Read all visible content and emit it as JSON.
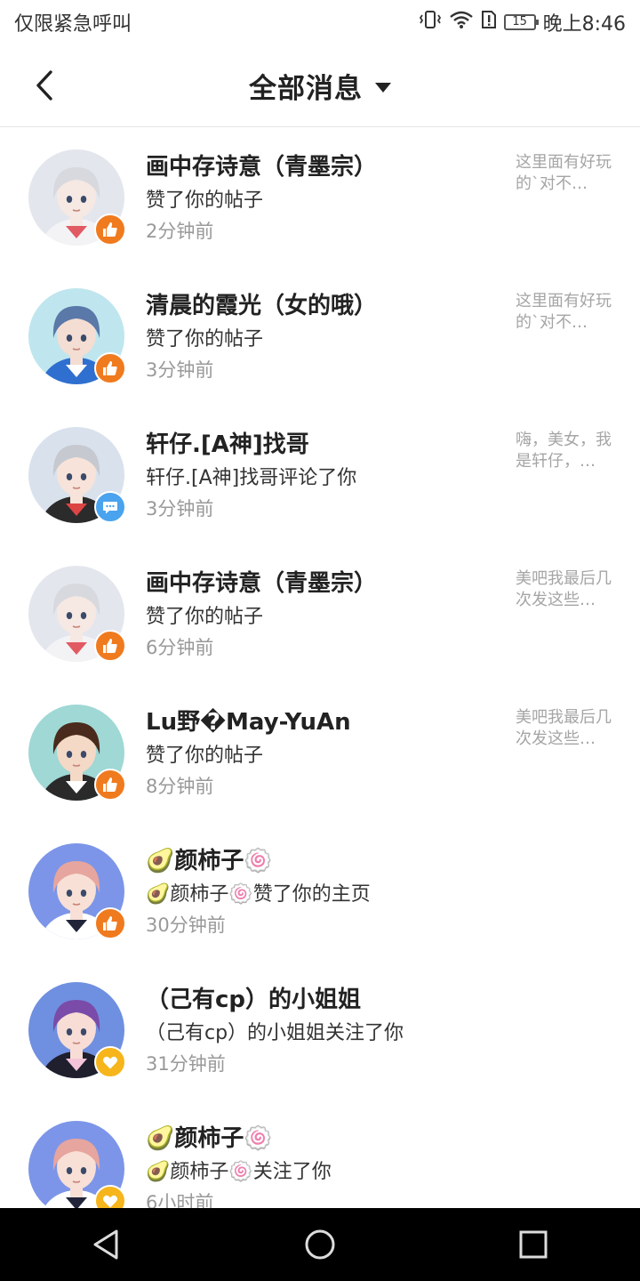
{
  "status_bar": {
    "carrier": "仅限紧急呼叫",
    "battery": "15",
    "battery_level_percent": 15,
    "time": "晚上8:46",
    "icons": [
      "vibrate-icon",
      "wifi-icon",
      "sim-alert-icon",
      "battery-icon"
    ]
  },
  "header": {
    "title": "全部消息",
    "back_icon": "chevron-left-icon",
    "dropdown_icon": "caret-down-icon"
  },
  "colors": {
    "like_badge": "#f07a1e",
    "comment_badge": "#4aa3ee",
    "follow_badge": "#f6b51b"
  },
  "messages": [
    {
      "name": "画中存诗意（青墨宗）",
      "action": "赞了你的帖子",
      "time": "2分钟前",
      "preview": "这里面有好玩的`对不…",
      "badge": "like",
      "badge_icon": "thumbs-up-icon"
    },
    {
      "name": "清晨的霞光（女的哦）",
      "action": "赞了你的帖子",
      "time": "3分钟前",
      "preview": "这里面有好玩的`对不…",
      "badge": "like",
      "badge_icon": "thumbs-up-icon"
    },
    {
      "name": "轩仔.[A神]找哥",
      "action": "轩仔.[A神]找哥评论了你",
      "time": "3分钟前",
      "preview": "嗨，美女，我是轩仔，…",
      "badge": "comment",
      "badge_icon": "comment-icon"
    },
    {
      "name": "画中存诗意（青墨宗）",
      "action": "赞了你的帖子",
      "time": "6分钟前",
      "preview": "美吧我最后几次发这些…",
      "badge": "like",
      "badge_icon": "thumbs-up-icon"
    },
    {
      "name": "Lu野�May-YuAn",
      "action": "赞了你的帖子",
      "time": "8分钟前",
      "preview": "美吧我最后几次发这些…",
      "badge": "like",
      "badge_icon": "thumbs-up-icon"
    },
    {
      "name": "🥑颜柿子🍥",
      "action": "🥑颜柿子🍥赞了你的主页",
      "time": "30分钟前",
      "preview": "",
      "badge": "like",
      "badge_icon": "thumbs-up-icon"
    },
    {
      "name": "（己有cp）的小姐姐",
      "action": "（己有cp）的小姐姐关注了你",
      "time": "31分钟前",
      "preview": "",
      "badge": "follow",
      "badge_icon": "heart-icon"
    },
    {
      "name": "🥑颜柿子🍥",
      "action": "🥑颜柿子🍥关注了你",
      "time": "6小时前",
      "preview": "",
      "badge": "follow",
      "badge_icon": "heart-icon"
    }
  ],
  "nav_bar": {
    "back": "triangle-back-icon",
    "home": "circle-home-icon",
    "recents": "square-recents-icon"
  }
}
